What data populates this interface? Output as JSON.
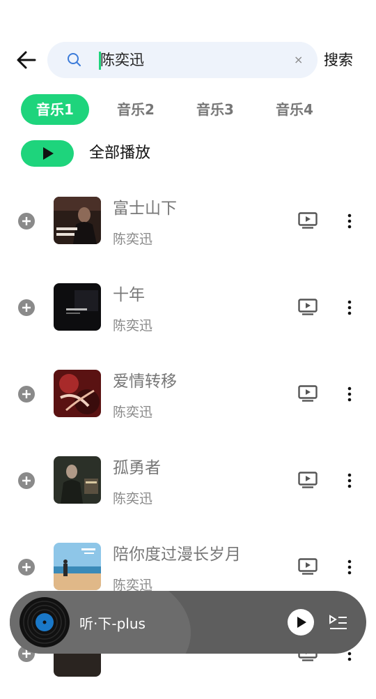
{
  "search": {
    "value": "陈奕迅",
    "clear_symbol": "×",
    "button_label": "搜索"
  },
  "tabs": [
    {
      "label": "音乐1",
      "active": true
    },
    {
      "label": "音乐2",
      "active": false
    },
    {
      "label": "音乐3",
      "active": false
    },
    {
      "label": "音乐4",
      "active": false
    }
  ],
  "play_all_label": "全部播放",
  "songs": [
    {
      "title": "富士山下",
      "artist": "陈奕迅"
    },
    {
      "title": "十年",
      "artist": "陈奕迅"
    },
    {
      "title": "爱情转移",
      "artist": "陈奕迅"
    },
    {
      "title": "孤勇者",
      "artist": "陈奕迅"
    },
    {
      "title": "陪你度过漫长岁月",
      "artist": "陈奕迅"
    }
  ],
  "player": {
    "title": "听·下-plus"
  },
  "colors": {
    "accent": "#1ed47c",
    "search_bg": "#eef3fb",
    "player_bg": "#5e5e5e"
  }
}
